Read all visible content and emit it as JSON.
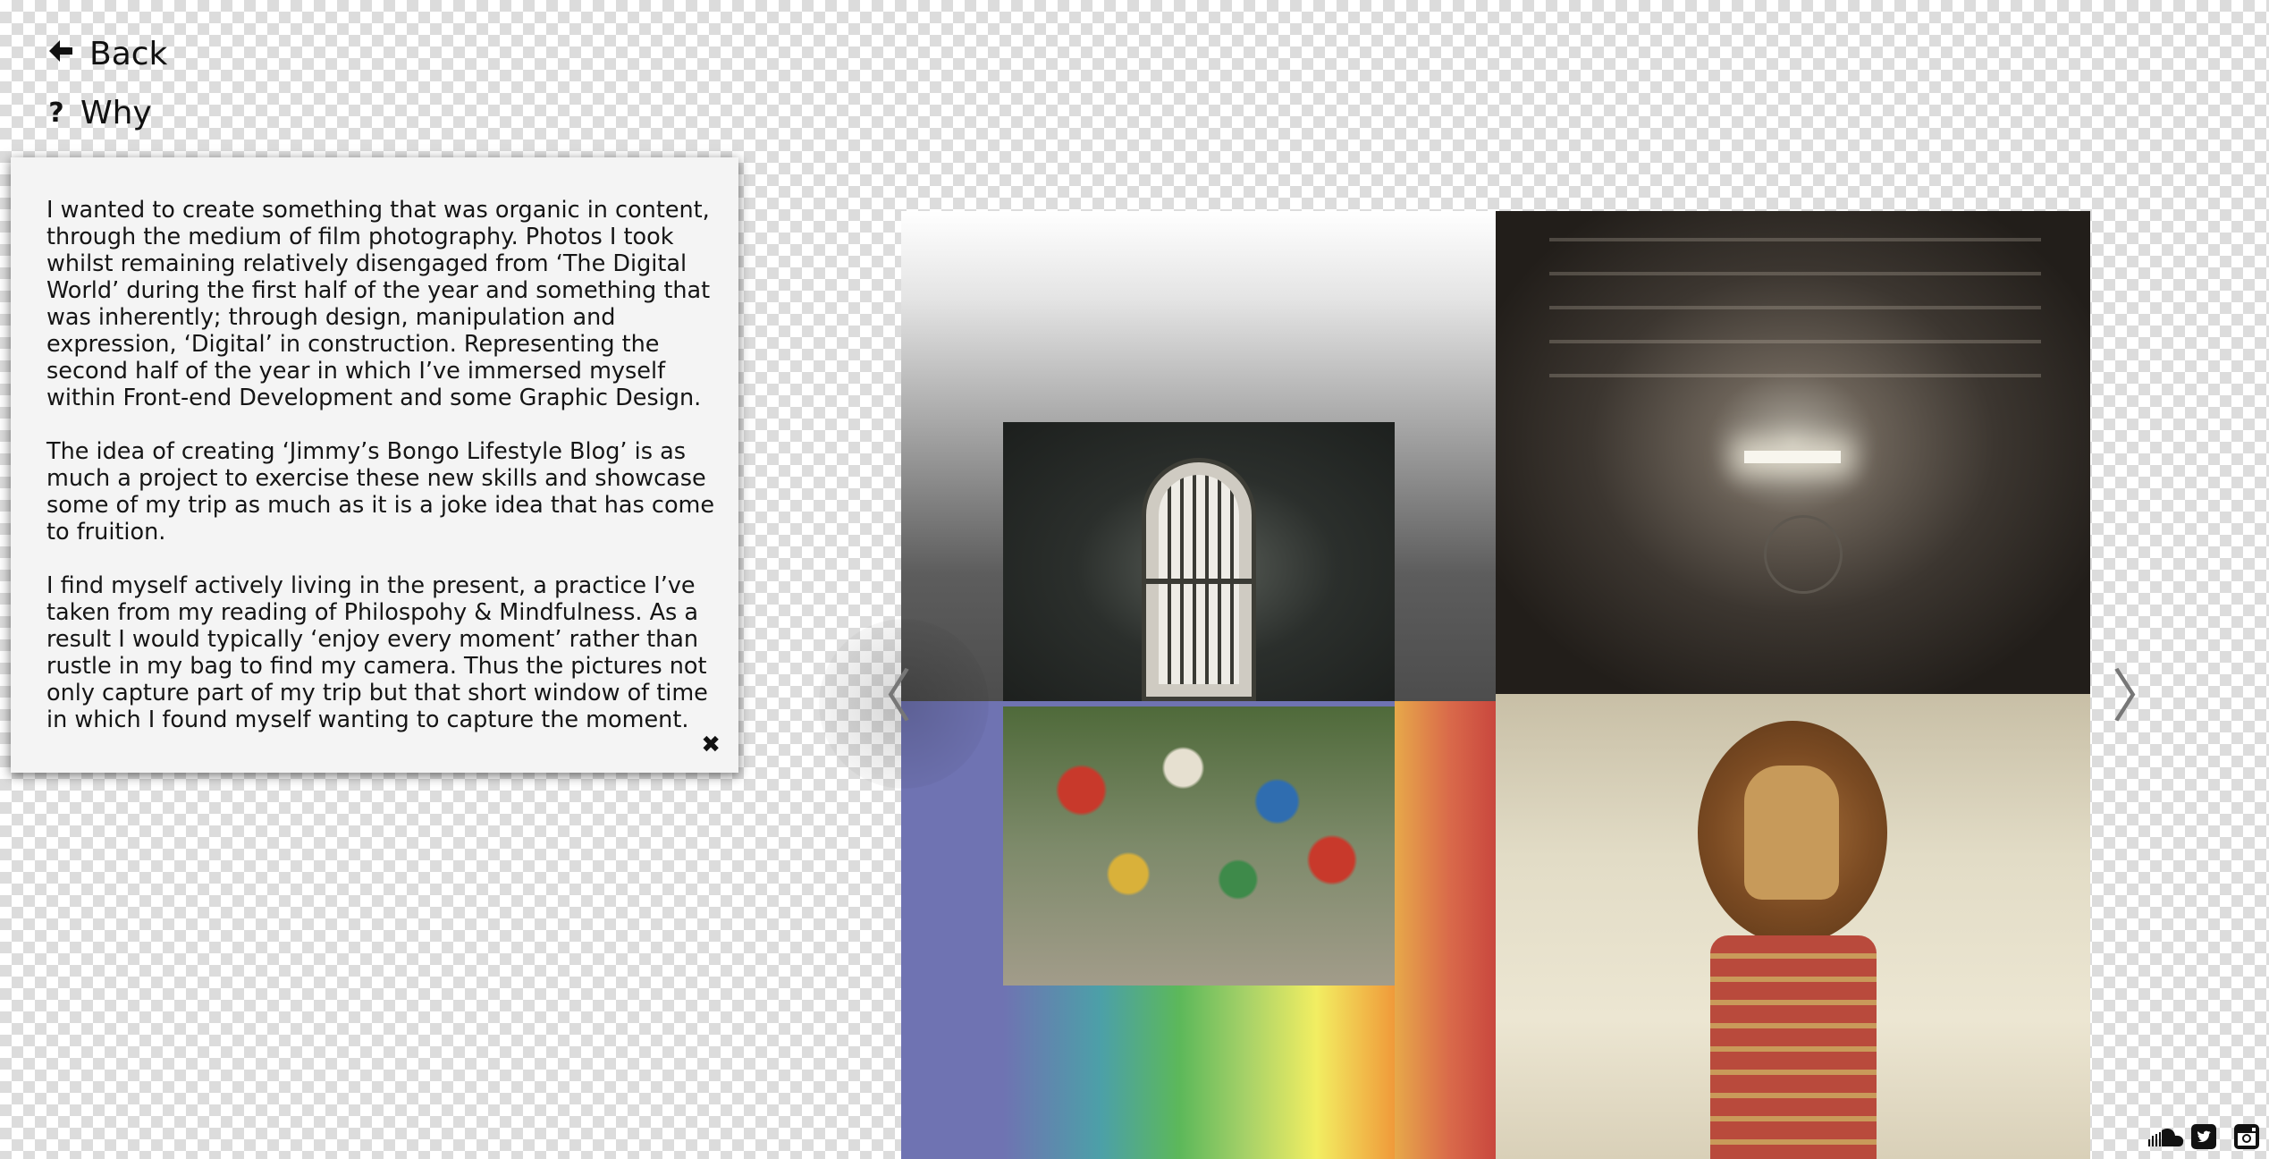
{
  "nav": {
    "back_label": "Back",
    "why_label": "Why"
  },
  "why_panel": {
    "paragraphs": [
      "I wanted to create something that was organic in content, through the medium of film photography. Photos I took whilst remaining relatively disengaged from ‘The Digital World’ during the first half of the year and something that was inherently; through design, manipulation and expression, ‘Digital’ in construction. Representing the second half of the year in which I’ve immersed myself within Front-end Development and some Graphic Design.",
      "The idea of creating ‘Jimmy’s Bongo Lifestyle Blog’ is as much a project to exercise these new skills and showcase some of my trip as much as it is a joke idea that has come to fruition.",
      "I find myself actively living in the present, a practice I’ve taken from my reading of Philospohy & Mindfulness. As a result I would typically ‘enjoy every moment’ rather than rustle in my bag to find my camera. Thus the pictures not only capture part of my trip but that short window of time in which I found myself wanting to capture the moment."
    ],
    "close_icon": "✖"
  },
  "gallery": {
    "prev_icon": "〈",
    "next_icon": "〉"
  },
  "icons": {
    "back": "arrow-left-icon",
    "why": "question-mark-icon"
  },
  "social": [
    "soundcloud-icon",
    "twitter-icon",
    "instagram-icon"
  ]
}
